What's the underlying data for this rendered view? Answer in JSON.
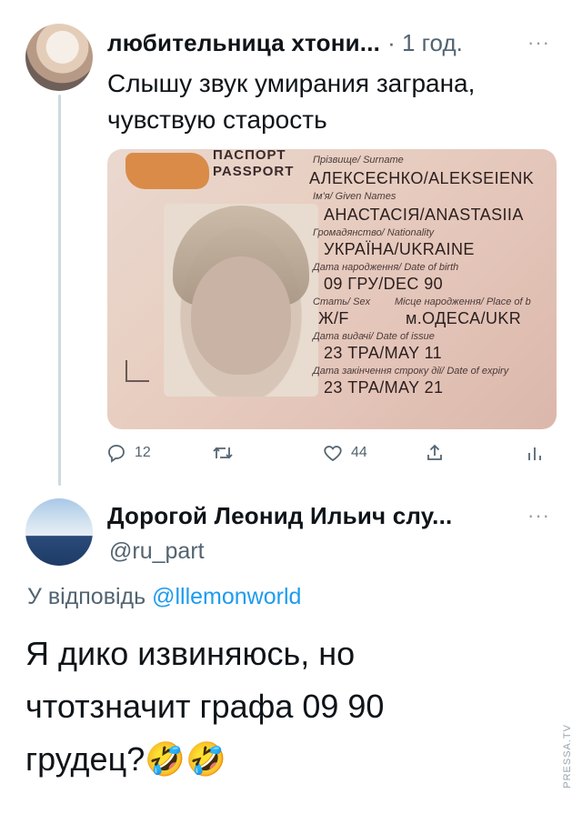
{
  "tweet1": {
    "author_name": "любительница хтони...",
    "time": "· 1 год.",
    "more": "···",
    "text_line1": "Слышу звук умирания заграна,",
    "text_line2": "чувствую старость",
    "passport": {
      "header_line1": "ПАСПОРТ",
      "header_line2": "PASSPORT",
      "surname_label": "Прізвище/ Surname",
      "surname": "АЛЕКСЕЄНКО/ALEKSEIENK",
      "given_label": "Ім'я/ Given Names",
      "given": "АНАСТАСІЯ/ANASTASIIA",
      "nationality_label": "Громадянство/ Nationality",
      "nationality": "УКРАЇНА/UKRAINE",
      "dob_label": "Дата народження/ Date of birth",
      "dob": "09 ГРУ/DEC 90",
      "sex_label": "Стать/ Sex",
      "sex": "Ж/F",
      "pob_label": "Місце народження/ Place of b",
      "pob": "м.ОДЕСА/UKR",
      "issue_label": "Дата видачі/ Date of issue",
      "issue": "23 ТРА/MAY 11",
      "expiry_label": "Дата закінчення строку дії/ Date of expiry",
      "expiry": "23 ТРА/MAY 21"
    },
    "actions": {
      "replies": "12",
      "retweets": "",
      "likes": "44"
    }
  },
  "tweet2": {
    "author_name": "Дорогой Леонид Ильич слу...",
    "handle": "@ru_part",
    "more": "···",
    "reply_prefix": "У відповідь",
    "reply_to": "@lllemonworld",
    "text_line1": "Я дико извиняюсь, но",
    "text_line2": "чтотзначит графа 09 90",
    "text_line3": "грудец?🤣🤣"
  },
  "watermark": "PRESSA.TV",
  "icons": {
    "reply": "reply-icon",
    "retweet": "retweet-icon",
    "like": "heart-icon",
    "share": "share-icon",
    "analytics": "analytics-icon",
    "more": "more-icon"
  },
  "colors": {
    "link": "#1d9bf0",
    "muted": "#536471",
    "thread_line": "#cfd9de"
  }
}
